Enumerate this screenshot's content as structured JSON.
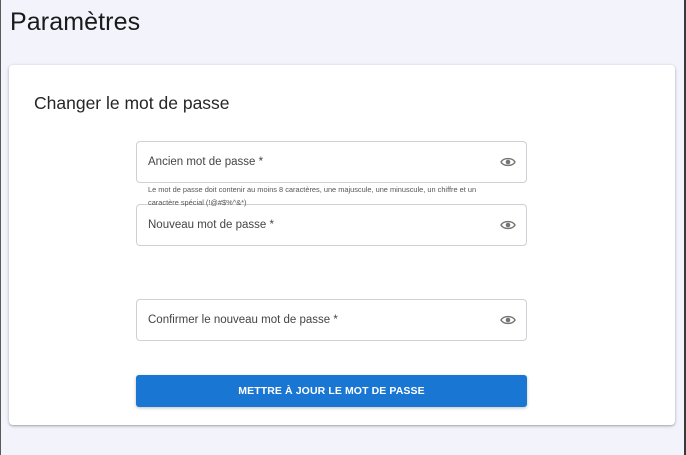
{
  "page": {
    "title": "Paramètres"
  },
  "card": {
    "title": "Changer le mot de passe"
  },
  "fields": {
    "old_password": {
      "label": "Ancien mot de passe *",
      "value": "",
      "icon": "eye-icon"
    },
    "new_password": {
      "label": "Nouveau mot de passe *",
      "value": "",
      "icon": "eye-icon",
      "helper": "Le mot de passe doit contenir au moins 8 caractères, une majuscule, une minuscule, un chiffre et un caractère spécial (!@#$%^&*)"
    },
    "confirm_password": {
      "label": "Confirmer le nouveau mot de passe *",
      "value": "",
      "icon": "eye-icon"
    }
  },
  "actions": {
    "submit_label": "METTRE À JOUR LE MOT DE PASSE"
  },
  "colors": {
    "page_background": "#f3f3fc",
    "card_background": "#ffffff",
    "primary": "#1976d2",
    "field_border": "#cfcfd6",
    "icon": "#757575"
  }
}
